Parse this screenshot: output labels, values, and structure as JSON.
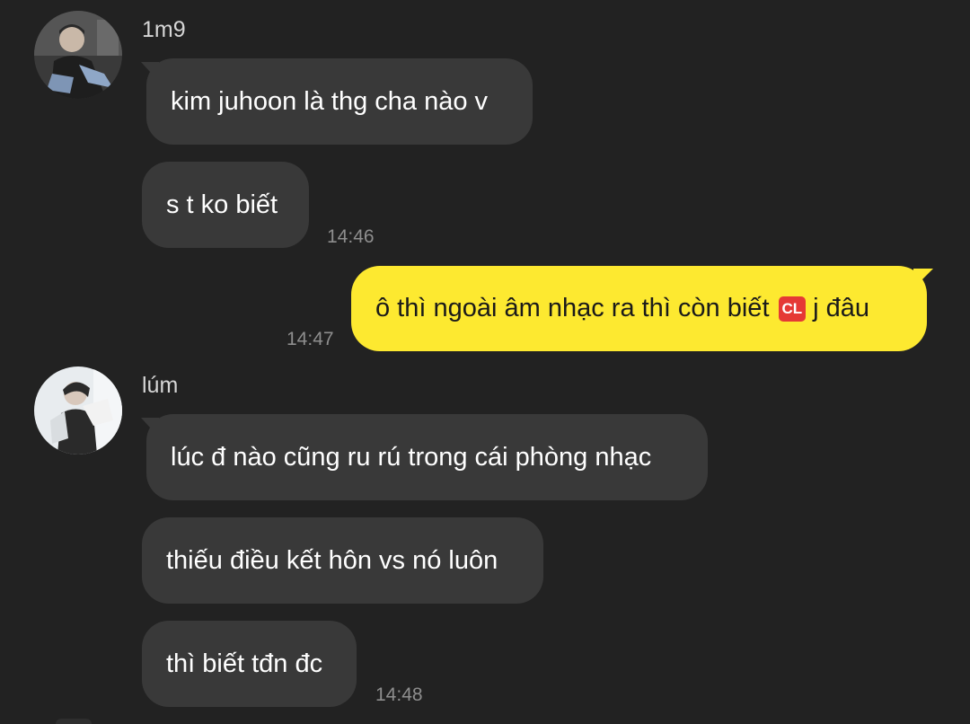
{
  "messages": [
    {
      "sender": "1m9",
      "avatar_icon": "person-photo-icon",
      "lines": [
        "kim juhoon là thg cha nào v",
        "s t ko biết"
      ],
      "time": "14:46"
    },
    {
      "sender": "me",
      "text_before": "ô thì ngoài âm nhạc ra thì còn biết",
      "badge": "CL",
      "text_after": "j đâu",
      "time": "14:47"
    },
    {
      "sender": "lúm",
      "avatar_icon": "person-photo-icon",
      "lines": [
        "lúc đ nào cũng ru rú trong cái phòng nhạc",
        "thiếu điều kết hôn vs nó luôn",
        "thì biết tđn đc"
      ],
      "time": "14:48"
    }
  ],
  "colors": {
    "background": "#222222",
    "incoming_bubble": "#393939",
    "outgoing_bubble": "#fde930",
    "badge": "#e53935"
  }
}
